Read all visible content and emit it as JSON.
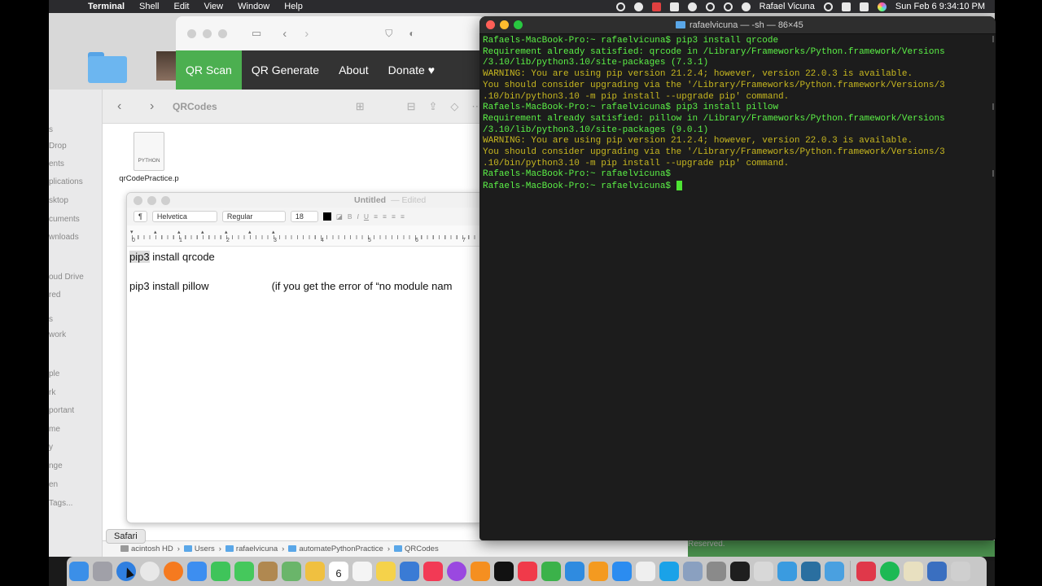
{
  "menubar": {
    "app": "Terminal",
    "menus": [
      "Shell",
      "Edit",
      "View",
      "Window",
      "Help"
    ],
    "user": "Rafael Vicuna",
    "clock": "Sun Feb 6  9:34:10 PM"
  },
  "safari_page": {
    "nav": [
      "QR Scan",
      "QR Generate",
      "About",
      "Donate ♥"
    ]
  },
  "finder": {
    "title": "QRCodes",
    "sidebar_fragments": [
      "s",
      "Drop",
      "ents",
      "plications",
      "sktop",
      "cuments",
      "wnloads",
      "oud Drive",
      "red",
      "s",
      "work",
      "ple",
      "rk",
      "portant",
      "me",
      "y",
      "nge",
      "en",
      "Tags..."
    ],
    "file_name": "qrCodePractice.p",
    "file_badge": "PYTHON",
    "path": [
      "acintosh HD",
      "Users",
      "rafaelvicuna",
      "automatePythonPractice",
      "QRCodes"
    ],
    "path_separator": "›"
  },
  "textedit": {
    "title": "Untitled",
    "edited": "— Edited",
    "paragraph_control": "¶",
    "font_family": "Helvetica",
    "font_style": "Regular",
    "font_size": "18",
    "bold": "B",
    "italic": "I",
    "underline": "U",
    "ruler_numbers": [
      "0",
      "1",
      "2",
      "3",
      "4",
      "5",
      "6",
      "7"
    ],
    "line1_highlight": "pip3",
    "line1_rest": " install qrcode",
    "line2_command": "pip3 install pillow",
    "line2_note": "(if you get the error of “no module nam"
  },
  "terminal": {
    "title": "rafaelvicuna — -sh — 86×45",
    "lines": [
      {
        "text": "Rafaels-MacBook-Pro:~ rafaelvicuna$ pip3 install qrcode",
        "color": "green"
      },
      {
        "text": "Requirement already satisfied: qrcode in /Library/Frameworks/Python.framework/Versions",
        "color": "green"
      },
      {
        "text": "/3.10/lib/python3.10/site-packages (7.3.1)",
        "color": "green"
      },
      {
        "text": "WARNING: You are using pip version 21.2.4; however, version 22.0.3 is available.",
        "color": "yellow"
      },
      {
        "text": "You should consider upgrading via the '/Library/Frameworks/Python.framework/Versions/3",
        "color": "yellow"
      },
      {
        "text": ".10/bin/python3.10 -m pip install --upgrade pip' command.",
        "color": "yellow"
      },
      {
        "text": "Rafaels-MacBook-Pro:~ rafaelvicuna$ pip3 install pillow",
        "color": "green"
      },
      {
        "text": "Requirement already satisfied: pillow in /Library/Frameworks/Python.framework/Versions",
        "color": "green"
      },
      {
        "text": "/3.10/lib/python3.10/site-packages (9.0.1)",
        "color": "green"
      },
      {
        "text": "WARNING: You are using pip version 21.2.4; however, version 22.0.3 is available.",
        "color": "yellow"
      },
      {
        "text": "You should consider upgrading via the '/Library/Frameworks/Python.framework/Versions/3",
        "color": "yellow"
      },
      {
        "text": ".10/bin/python3.10 -m pip install --upgrade pip' command.",
        "color": "yellow"
      },
      {
        "text": "Rafaels-MacBook-Pro:~ rafaelvicuna$",
        "color": "green"
      },
      {
        "text": "Rafaels-MacBook-Pro:~ rafaelvicuna$ ",
        "color": "green",
        "cursor": true
      }
    ]
  },
  "background_text": {
    "reserved": "Reserved."
  },
  "tooltip": "Safari",
  "dock": {
    "calendar_day": "6",
    "icons": [
      {
        "name": "finder",
        "color": "#3b8fe8"
      },
      {
        "name": "launchpad",
        "color": "#a0a0a8"
      },
      {
        "name": "safari",
        "color": "#2f7fe0"
      },
      {
        "name": "chrome",
        "color": "#e8e8e8"
      },
      {
        "name": "firefox",
        "color": "#f57a1f"
      },
      {
        "name": "mail",
        "color": "#3d8ef0"
      },
      {
        "name": "facetime",
        "color": "#3fc45a"
      },
      {
        "name": "messages",
        "color": "#45c85c"
      },
      {
        "name": "notes-brown",
        "color": "#b08850"
      },
      {
        "name": "maps",
        "color": "#6ab56a"
      },
      {
        "name": "photos",
        "color": "#f0c040"
      },
      {
        "name": "calendar",
        "color": "#ffffff"
      },
      {
        "name": "reminders",
        "color": "#f4f4f4"
      },
      {
        "name": "notes",
        "color": "#f5d24a"
      },
      {
        "name": "xcode",
        "color": "#3a7bd5"
      },
      {
        "name": "music",
        "color": "#f23a55"
      },
      {
        "name": "podcasts",
        "color": "#9a48e0"
      },
      {
        "name": "books",
        "color": "#f58f20"
      },
      {
        "name": "tv",
        "color": "#111111"
      },
      {
        "name": "news",
        "color": "#f03a4a"
      },
      {
        "name": "numbers",
        "color": "#3bb24a"
      },
      {
        "name": "keynote",
        "color": "#2f8be0"
      },
      {
        "name": "pages",
        "color": "#f49a20"
      },
      {
        "name": "app-store",
        "color": "#2b8cf0"
      },
      {
        "name": "textedit",
        "color": "#efefef"
      },
      {
        "name": "skype",
        "color": "#1aa2e8"
      },
      {
        "name": "preview",
        "color": "#8aa0c0"
      },
      {
        "name": "system-preferences",
        "color": "#8a8a8a"
      },
      {
        "name": "terminal",
        "color": "#1e1e1e"
      },
      {
        "name": "finder-folder",
        "color": "#d8d8d8"
      },
      {
        "name": "folder-blue",
        "color": "#3a9be0"
      },
      {
        "name": "quicktime",
        "color": "#2a6fa0"
      },
      {
        "name": "migration",
        "color": "#4aa0e0"
      }
    ],
    "after_sep": [
      {
        "name": "app-red",
        "color": "#e0384a"
      },
      {
        "name": "spotify",
        "color": "#1db954"
      },
      {
        "name": "script-editor",
        "color": "#e8e0c0"
      },
      {
        "name": "downloads",
        "color": "#3a6fc0"
      },
      {
        "name": "trash",
        "color": "#cfcfcf"
      }
    ]
  }
}
